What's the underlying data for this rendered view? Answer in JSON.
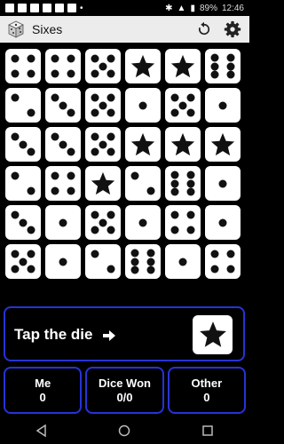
{
  "status_bar": {
    "battery": "89%",
    "time": "12:46"
  },
  "app": {
    "title": "Sixes"
  },
  "board": {
    "dice": [
      [
        4,
        4,
        5,
        "star",
        "star",
        6
      ],
      [
        2,
        3,
        5,
        1,
        5,
        1
      ],
      [
        3,
        3,
        5,
        "star",
        "star",
        "star"
      ],
      [
        2,
        4,
        "star",
        2,
        6,
        1
      ],
      [
        3,
        1,
        5,
        1,
        4,
        1
      ],
      [
        5,
        1,
        2,
        6,
        1,
        4
      ]
    ]
  },
  "prompt": {
    "text": "Tap the die",
    "target_die": "star"
  },
  "scores": [
    {
      "label": "Me",
      "value": "0"
    },
    {
      "label": "Dice Won",
      "value": "0/0"
    },
    {
      "label": "Other",
      "value": "0"
    }
  ],
  "colors": {
    "panel_border": "#2733d6",
    "background": "#000000",
    "app_bar": "#ececec"
  },
  "icons": {
    "refresh": "refresh-icon",
    "settings": "gear-icon",
    "back": "back-icon",
    "home": "home-icon",
    "recents": "recents-icon"
  }
}
